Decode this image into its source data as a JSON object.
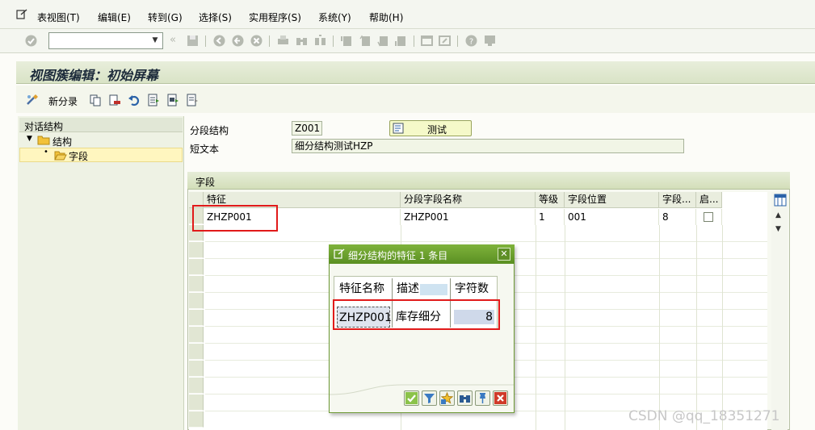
{
  "menu": {
    "items": [
      "表视图(T)",
      "编辑(E)",
      "转到(G)",
      "选择(S)",
      "实用程序(S)",
      "系统(Y)",
      "帮助(H)"
    ]
  },
  "toolbar": {
    "command_field_value": "",
    "icons": [
      "enter-icon",
      "save-icon",
      "back-icon",
      "exit-icon",
      "cancel-icon",
      "print-icon",
      "find-icon",
      "find-next-icon",
      "first-page-icon",
      "previous-page-icon",
      "next-page-icon",
      "last-page-icon",
      "create-session-icon",
      "shortcut-icon",
      "help-icon",
      "customize-layout-icon"
    ]
  },
  "title": "视图簇编辑：初始屏幕",
  "app_toolbar": {
    "new_entries_label": "新分录"
  },
  "tree": {
    "header": "对话结构",
    "items": [
      {
        "label": "结构",
        "expanded": true
      },
      {
        "label": "字段",
        "selected": true
      }
    ]
  },
  "form": {
    "segment_structure_label": "分段结构",
    "segment_structure_value": "Z001",
    "short_text_label": "短文本",
    "short_text_value": "细分结构测试HZP",
    "test_button_label": "测试"
  },
  "group": {
    "title": "字段",
    "columns": [
      "特征",
      "分段字段名称",
      "等级",
      "字段位置",
      "字段...",
      "启..."
    ],
    "rows": [
      {
        "feature": "ZHZP001",
        "segment_field_name": "ZHZP001",
        "level": "1",
        "field_position": "001",
        "field_length": "8",
        "enabled": false
      }
    ]
  },
  "popup": {
    "title": "细分结构的特征 1 条目",
    "columns": [
      "特征名称",
      "描述",
      "字符数"
    ],
    "rows": [
      {
        "name": "ZHZP001",
        "description": "库存细分",
        "chars": "8"
      }
    ],
    "buttons": [
      "confirm-icon",
      "filter-icon",
      "new-selection-icon",
      "find-icon",
      "pin-icon",
      "cancel-icon"
    ]
  },
  "watermark": "CSDN @qq_18351271",
  "colors": {
    "title_bar": "#d9e3c6",
    "popup_title": "#5a8f22",
    "highlight": "#e11a1a",
    "selected_tree_item": "#fff6bf"
  }
}
